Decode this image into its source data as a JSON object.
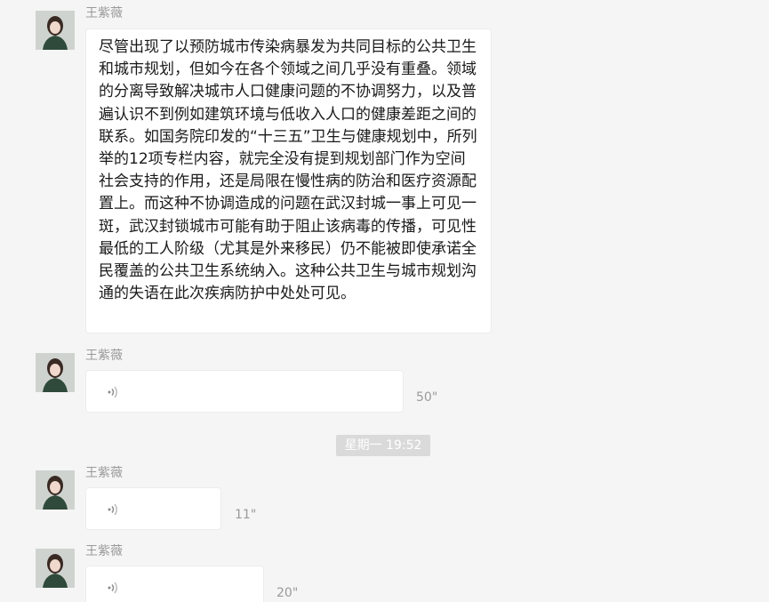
{
  "messages": [
    {
      "sender": "王紫薇",
      "type": "text",
      "text": "尽管出现了以预防城市传染病暴发为共同目标的公共卫生和城市规划，但如今在各个领域之间几乎没有重叠。领域的分离导致解决城市人口健康问题的不协调努力，以及普遍认识不到例如建筑环境与低收入人口的健康差距之间的联系。如国务院印发的“十三五”卫生与健康规划中，所列举的12项专栏内容，就完全没有提到规划部门作为空间社会支持的作用，还是局限在慢性病的防治和医疗资源配置上。而这种不协调造成的问题在武汉封城一事上可见一斑，武汉封锁城市可能有助于阻止该病毒的传播，可见性最低的工人阶级（尤其是外来移民）仍不能被即使承诺全民覆盖的公共卫生系统纳入。这种公共卫生与城市规划沟通的失语在此次疾病防护中处处可见。"
    },
    {
      "sender": "王紫薇",
      "type": "voice",
      "duration": "50\""
    },
    {
      "sender": "王紫薇",
      "type": "voice",
      "duration": "11\""
    },
    {
      "sender": "王紫薇",
      "type": "voice",
      "duration": "20\""
    }
  ],
  "timestamp": "星期一 19:52",
  "icons": {
    "avatar": "avatar-photo",
    "voice": "voice-wave-icon"
  },
  "colors": {
    "background": "#f5f5f5",
    "bubble": "#ffffff",
    "meta_text": "#9a9a9a",
    "timestamp_bg": "#dadada"
  }
}
